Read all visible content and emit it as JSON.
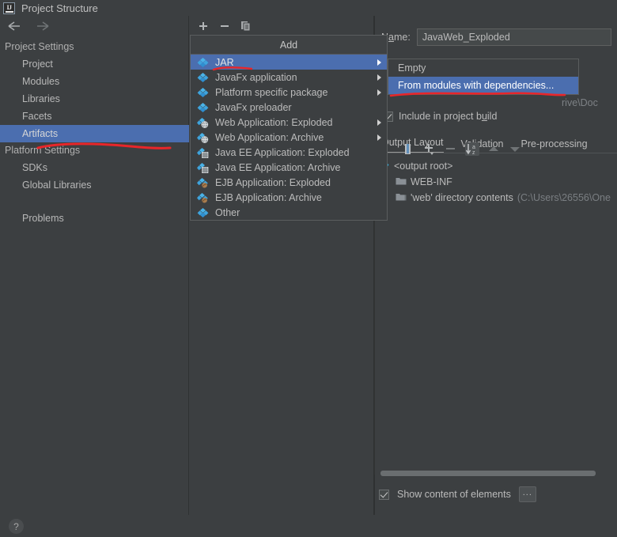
{
  "window": {
    "title": "Project Structure",
    "logo_text": "IJ"
  },
  "nav": {
    "back_icon": "arrow-left-icon",
    "forward_icon": "arrow-right-icon"
  },
  "sidebar": {
    "groups": [
      {
        "label": "Project Settings",
        "items": [
          {
            "label": "Project",
            "selected": false
          },
          {
            "label": "Modules",
            "selected": false
          },
          {
            "label": "Libraries",
            "selected": false
          },
          {
            "label": "Facets",
            "selected": false
          },
          {
            "label": "Artifacts",
            "selected": true
          }
        ]
      },
      {
        "label": "Platform Settings",
        "items": [
          {
            "label": "SDKs",
            "selected": false
          },
          {
            "label": "Global Libraries",
            "selected": false
          }
        ]
      }
    ],
    "problems": "Problems"
  },
  "artifacts_toolbar": {
    "add": "+",
    "remove": "−",
    "copy_icon": "copy-icon"
  },
  "add_menu": {
    "header": "Add",
    "items": [
      {
        "label": "JAR",
        "icon": "artifact-gem-icon",
        "submenu": true,
        "selected": true
      },
      {
        "label": "JavaFx application",
        "icon": "artifact-gem-icon",
        "submenu": true,
        "selected": false
      },
      {
        "label": "Platform specific package",
        "icon": "artifact-gem-icon",
        "submenu": true,
        "selected": false
      },
      {
        "label": "JavaFx preloader",
        "icon": "artifact-gem-icon",
        "submenu": false,
        "selected": false
      },
      {
        "label": "Web Application: Exploded",
        "icon": "web-artifact-icon",
        "submenu": true,
        "selected": false
      },
      {
        "label": "Web Application: Archive",
        "icon": "web-artifact-icon",
        "submenu": true,
        "selected": false
      },
      {
        "label": "Java EE Application: Exploded",
        "icon": "javaee-artifact-icon",
        "submenu": false,
        "selected": false
      },
      {
        "label": "Java EE Application: Archive",
        "icon": "javaee-artifact-icon",
        "submenu": false,
        "selected": false
      },
      {
        "label": "EJB Application: Exploded",
        "icon": "ejb-artifact-icon",
        "submenu": false,
        "selected": false
      },
      {
        "label": "EJB Application: Archive",
        "icon": "ejb-artifact-icon",
        "submenu": false,
        "selected": false
      },
      {
        "label": "Other",
        "icon": "artifact-gem-icon",
        "submenu": false,
        "selected": false
      }
    ]
  },
  "jar_submenu": {
    "items": [
      {
        "label": "Empty",
        "selected": false
      },
      {
        "label": "From modules with dependencies...",
        "selected": true
      }
    ]
  },
  "details": {
    "name_label": "Name:",
    "name_value": "JavaWeb_Exploded",
    "name_placeholder": "",
    "include_in_build_label": "Include in project build",
    "include_in_build_checked": true,
    "tabs": [
      {
        "label": "Output Layout",
        "active": true
      },
      {
        "label": "Validation",
        "active": false
      },
      {
        "label": "Pre-processing",
        "active": false
      }
    ],
    "layout_toolbar": [
      {
        "icon": "add-copy-of-icon",
        "active": false
      },
      {
        "icon": "archive-icon",
        "active": false
      },
      {
        "icon": "add-dropdown-icon",
        "active": false
      },
      {
        "icon": "minus-icon",
        "active": false
      },
      {
        "icon": "sort-alphabetically-icon",
        "active": true
      },
      {
        "icon": "move-up-icon",
        "active": false
      },
      {
        "icon": "move-down-icon",
        "active": false
      }
    ],
    "output_tree": [
      {
        "icon": "output-root-icon",
        "label": "<output root>",
        "dim": "",
        "indent": false
      },
      {
        "icon": "folder-icon",
        "label": "WEB-INF",
        "dim": "",
        "indent": true
      },
      {
        "icon": "folder-copy-icon",
        "label": "'web' directory contents",
        "dim": "(C:\\Users\\26556\\One",
        "indent": true
      }
    ],
    "path_clipped": "rive\\Doc",
    "show_content_label": "Show content of elements",
    "show_content_checked": true,
    "dots_button_label": "..."
  },
  "footer": {
    "help_icon": "help-question-icon"
  },
  "annotations": [
    {
      "name": "red-underline-artifacts"
    },
    {
      "name": "red-underline-jar"
    },
    {
      "name": "red-underline-from-modules"
    }
  ],
  "colors": {
    "background": "#3c3f41",
    "selection_blue": "#4b6eaf",
    "text": "#bbbbbb",
    "dim_text": "#7a7e82",
    "annotation_red": "#e8262a",
    "icon_blue": "#3592dd"
  }
}
